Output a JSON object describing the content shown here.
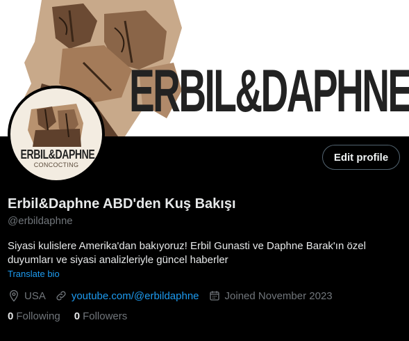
{
  "banner": {
    "wordmark": "ERBIL&DAPHNE"
  },
  "avatar": {
    "wordmark": "ERBIL&DAPHNE",
    "subtitle": "CONCOCTING"
  },
  "actions": {
    "edit_profile_label": "Edit profile"
  },
  "profile": {
    "display_name": "Erbil&Daphne ABD'den Kuş Bakışı",
    "handle": "@erbildaphne",
    "bio": "Siyasi kulislere Amerika'dan bakıyoruz! Erbil Gunasti ve Daphne Barak'ın özel duyumları ve siyasi analizleriyle güncel haberler",
    "translate_label": "Translate bio",
    "location": "USA",
    "website": "youtube.com/@erbildaphne",
    "joined": "Joined November 2023"
  },
  "stats": {
    "following_count": "0",
    "following_label": "Following",
    "followers_count": "0",
    "followers_label": "Followers"
  },
  "icons": {
    "location": "location-pin-icon",
    "website": "link-icon",
    "joined": "calendar-icon"
  },
  "colors": {
    "background": "#000000",
    "accent": "#1d9bf0",
    "text_primary": "#e7e9ea",
    "text_secondary": "#71767b",
    "button_border": "#536471"
  }
}
